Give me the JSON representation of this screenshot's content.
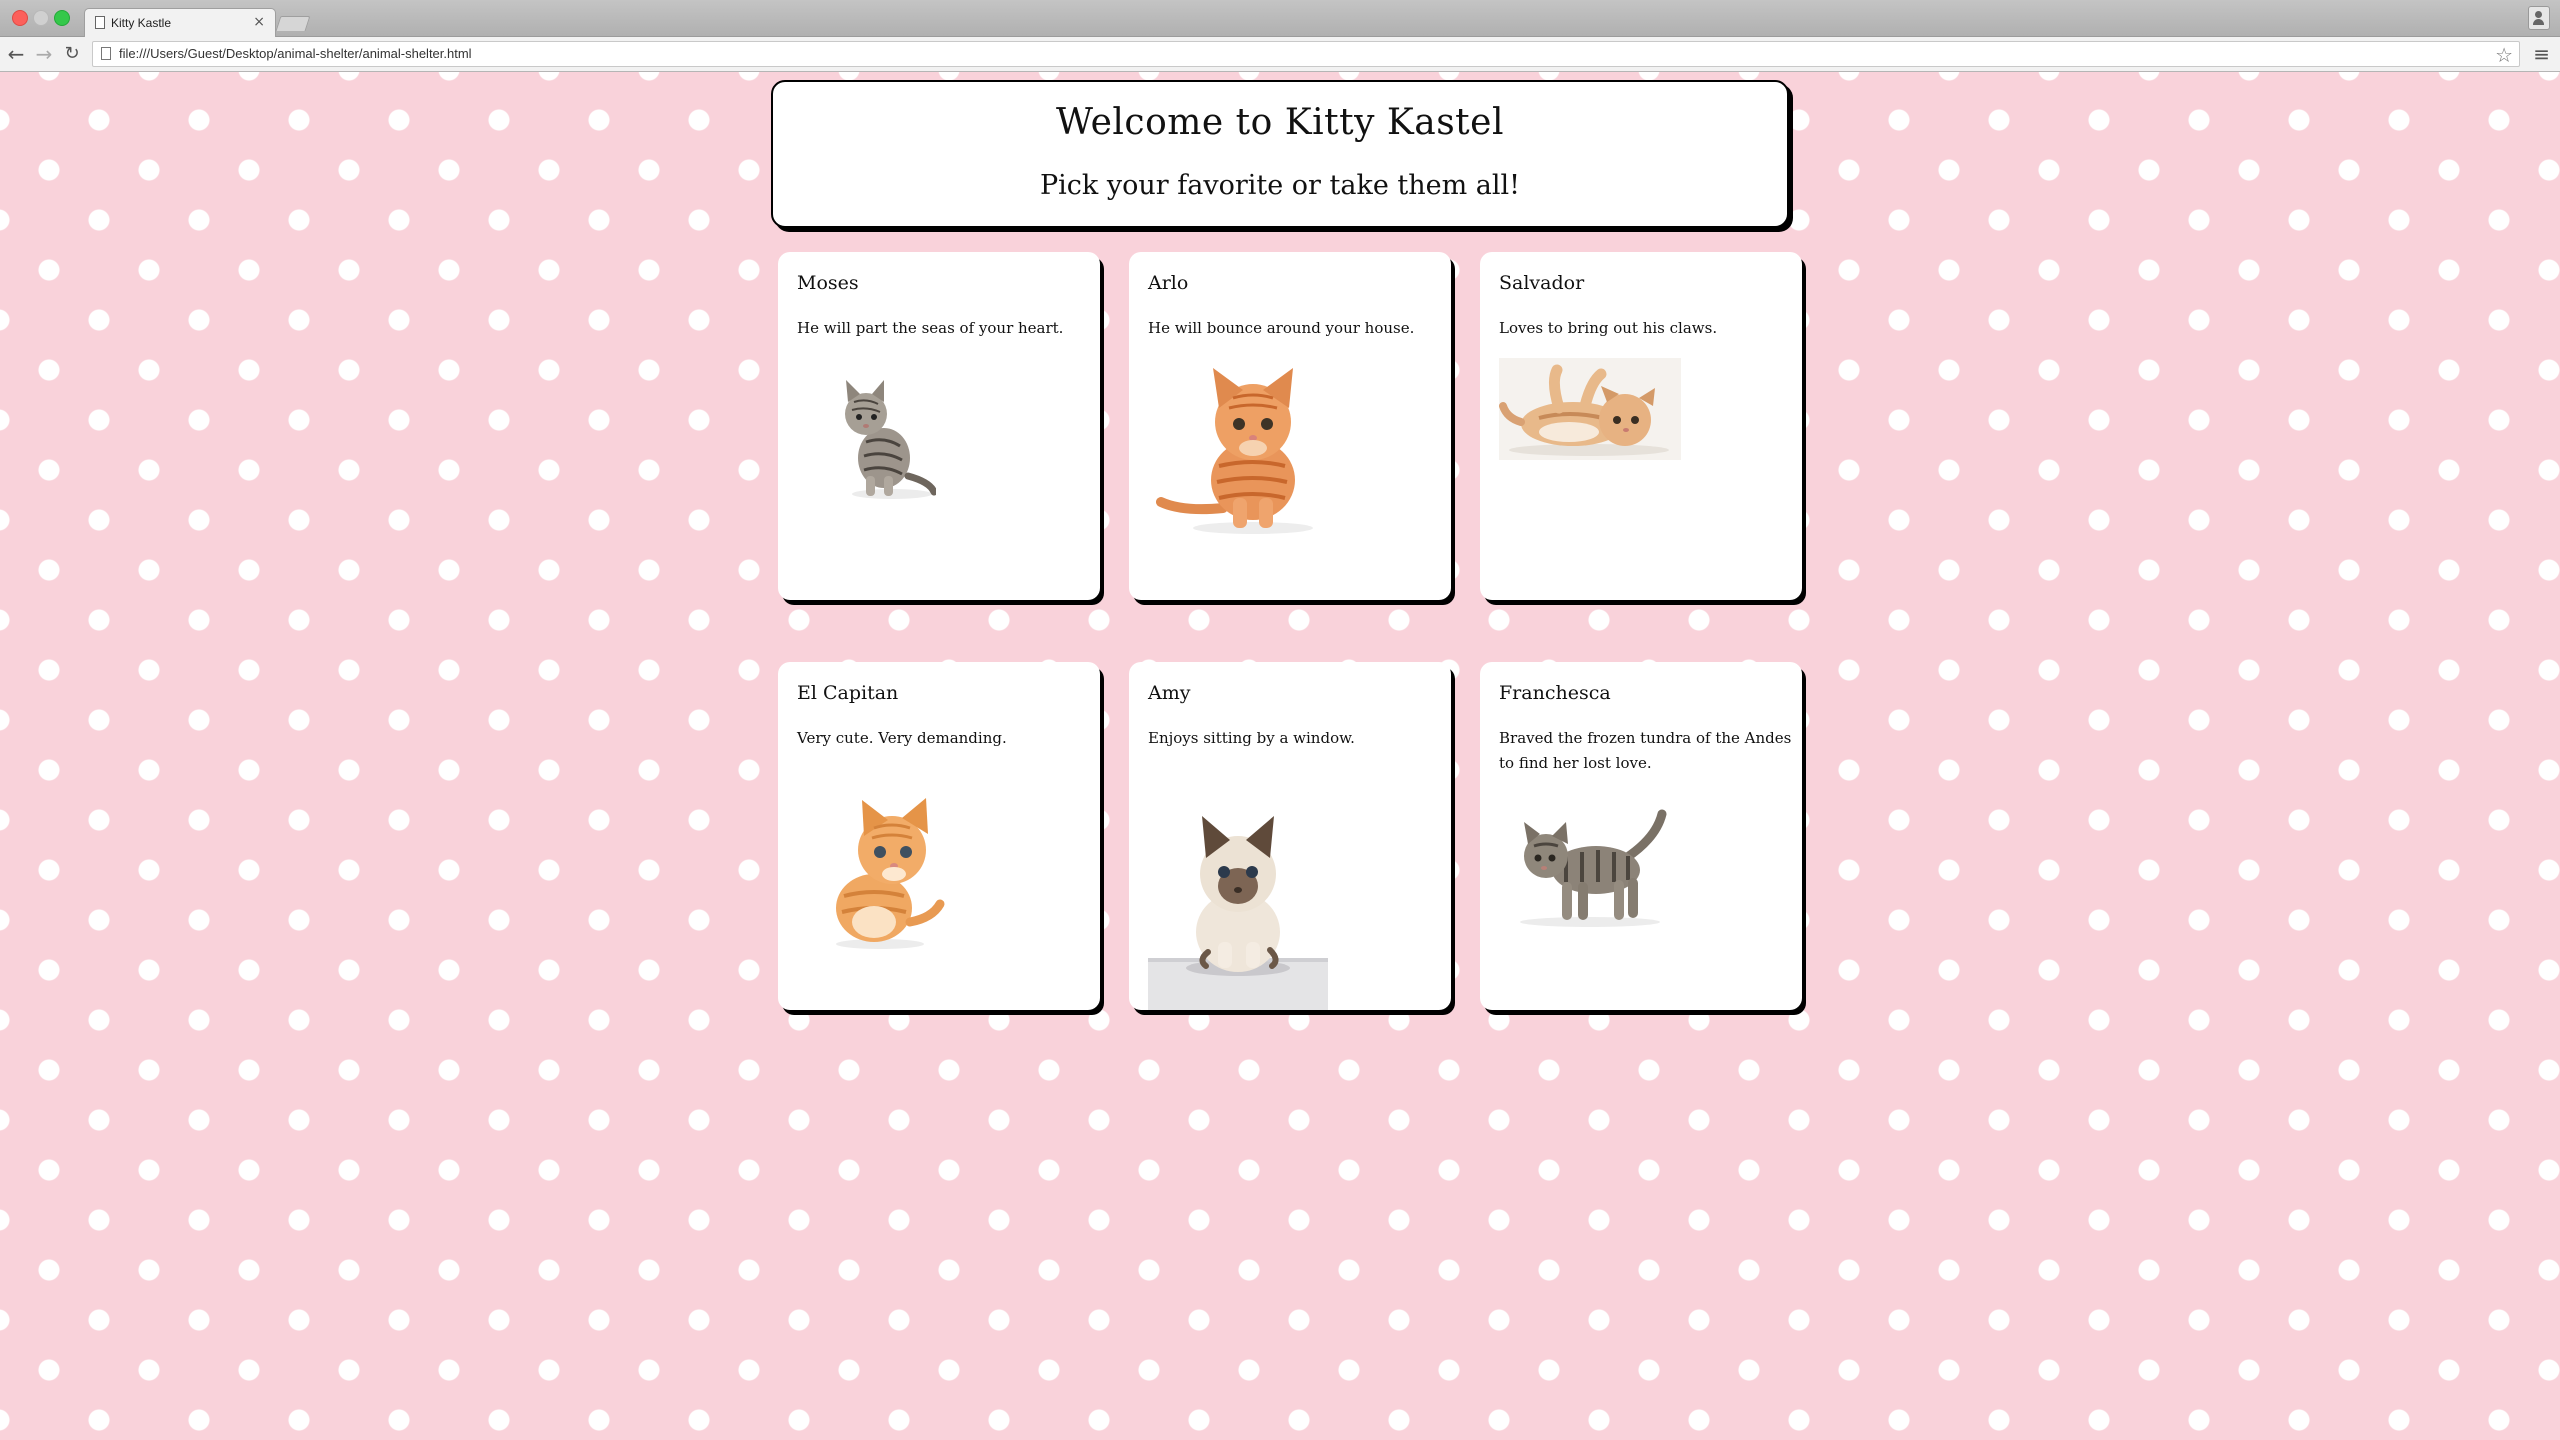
{
  "browser": {
    "tab_title": "Kitty Kastle",
    "tab_close": "×",
    "url": "file:///Users/Guest/Desktop/animal-shelter/animal-shelter.html",
    "back_glyph": "←",
    "forward_glyph": "→",
    "reload_glyph": "↻",
    "star_glyph": "☆",
    "menu_glyph": "≡"
  },
  "header": {
    "title": "Welcome to Kitty Kastel",
    "subtitle": "Pick your favorite or take them all!"
  },
  "cats": [
    {
      "name": "Moses",
      "description": "He will part the seas of your heart.",
      "icon": "tabby-kitten-image"
    },
    {
      "name": "Arlo",
      "description": "He will bounce around your house.",
      "icon": "orange-kitten-image"
    },
    {
      "name": "Salvador",
      "description": "Loves to bring out his claws.",
      "icon": "lying-kitten-image"
    },
    {
      "name": "El Capitan",
      "description": "Very cute. Very demanding.",
      "icon": "ginger-kitten-image"
    },
    {
      "name": "Amy",
      "description": "Enjoys sitting by a window.",
      "icon": "siamese-kitten-image"
    },
    {
      "name": "Franchesca",
      "description": "Braved the frozen tundra of the Andes to find her lost love.",
      "icon": "grey-tabby-kitten-image"
    }
  ],
  "colors": {
    "page_background": "#f9d2da",
    "polka_dot": "#ffffff",
    "card_background": "#ffffff",
    "card_shadow": "#000000"
  }
}
